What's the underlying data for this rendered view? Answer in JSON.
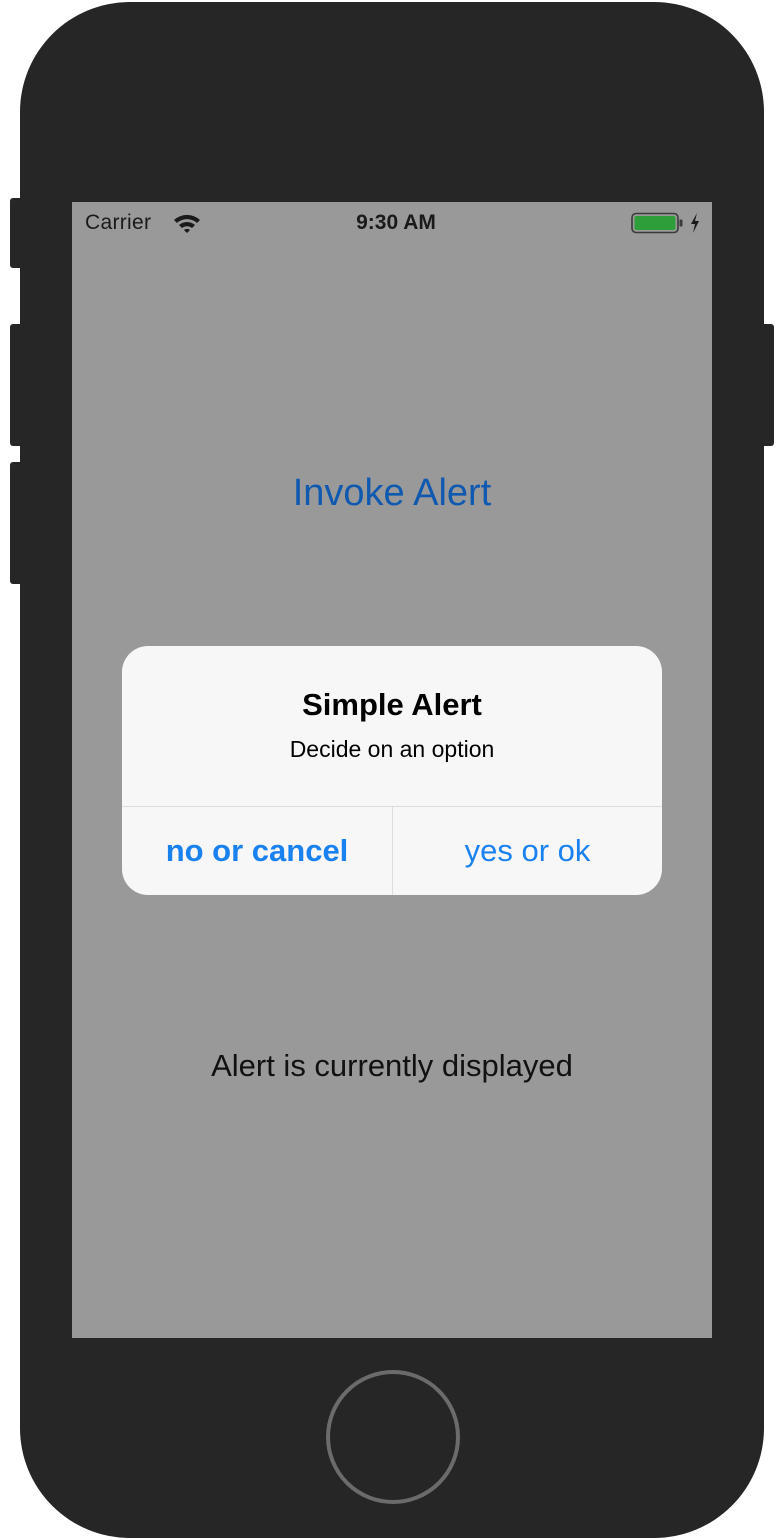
{
  "status_bar": {
    "carrier": "Carrier",
    "time": "9:30 AM",
    "wifi_icon": "wifi-icon",
    "battery_icon": "battery-icon",
    "charging_icon": "bolt-icon",
    "battery_color": "#2e9e3a"
  },
  "main": {
    "invoke_button_label": "Invoke Alert",
    "status_text": "Alert is currently displayed"
  },
  "alert": {
    "title": "Simple Alert",
    "message": "Decide on an option",
    "actions": [
      {
        "label": "no or cancel",
        "style": "cancel"
      },
      {
        "label": "yes or ok",
        "style": "default"
      }
    ]
  },
  "colors": {
    "tint": "#1a82f0",
    "dimmed_background": "#999999",
    "device_body": "#262626"
  }
}
